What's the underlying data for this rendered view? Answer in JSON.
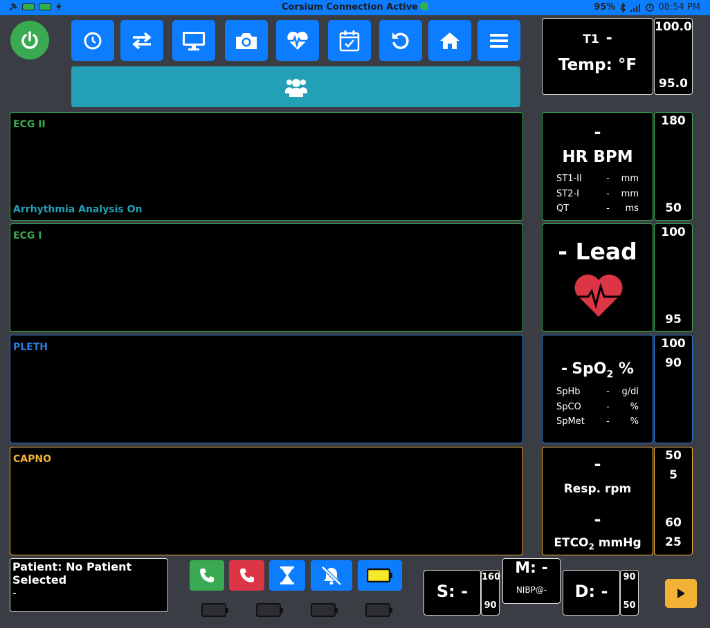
{
  "status_bar": {
    "center_text": "Corsium Connection Active",
    "battery_percent": "95%",
    "time": "08:54 PM"
  },
  "temp": {
    "label": "T1",
    "value": "-",
    "units": "Temp: °F",
    "high_limit": "100.0",
    "low_limit": "95.0"
  },
  "waveforms": {
    "ecg2": {
      "label": "ECG II",
      "note": "Arrhythmia Analysis On"
    },
    "ecg1": {
      "label": "ECG I"
    },
    "pleth": {
      "label": "PLETH"
    },
    "capno": {
      "label": "CAPNO"
    }
  },
  "hr": {
    "value": "-",
    "units": "HR BPM",
    "rows": [
      {
        "name": "ST1-II",
        "value": "-",
        "unit": "mm"
      },
      {
        "name": "ST2-I",
        "value": "-",
        "unit": "mm"
      },
      {
        "name": "QT",
        "value": "-",
        "unit": "ms"
      }
    ],
    "high_limit": "180",
    "low_limit": "50"
  },
  "lead": {
    "value": "-",
    "label": "Lead",
    "high_limit": "100",
    "low_limit": "95"
  },
  "spo2": {
    "value": "-",
    "label_prefix": "SpO",
    "label_sub": "2",
    "label_suffix": " %",
    "rows": [
      {
        "name": "SpHb",
        "value": "-",
        "unit": "g/dl"
      },
      {
        "name": "SpCO",
        "value": "-",
        "unit": "%"
      },
      {
        "name": "SpMet",
        "value": "-",
        "unit": "%"
      }
    ],
    "high_limit": "100",
    "low_limit": "90"
  },
  "capno_num": {
    "resp_value": "-",
    "resp_units": "Resp. rpm",
    "etco2_value": "-",
    "etco2_prefix": "ETCO",
    "etco2_sub": "2",
    "etco2_suffix": " mmHg",
    "resp_high": "50",
    "resp_low": "5",
    "etco2_high": "60",
    "etco2_low": "25"
  },
  "patient": {
    "line1": "Patient: No Patient Selected",
    "line2": "-"
  },
  "nibp": {
    "sys_label": "S: -",
    "sys_high": "160",
    "sys_low": "90",
    "mean_label": "M: -",
    "mean_sub": "NIBP@-",
    "dia_label": "D: -",
    "dia_high": "90",
    "dia_low": "50"
  },
  "colors": {
    "toolbar_blue": "#0d7dff",
    "power_green": "#3aaa52",
    "group_teal": "#23a0b6",
    "ecg_green": "#3aaa52",
    "pleth_blue": "#2a7de0",
    "capno_orange": "#f2b236",
    "alarm_red": "#dc3545",
    "arrhythmia_text": "#23a0b6"
  },
  "icons": [
    "power-icon",
    "clock-icon",
    "swap-icon",
    "monitor-icon",
    "camera-icon",
    "heartbeat-icon",
    "calendar-check-icon",
    "undo-icon",
    "home-icon",
    "menu-icon",
    "users-icon",
    "phone-icon",
    "phone-hangup-icon",
    "hourglass-icon",
    "bell-slash-icon",
    "battery-icon",
    "play-icon"
  ]
}
